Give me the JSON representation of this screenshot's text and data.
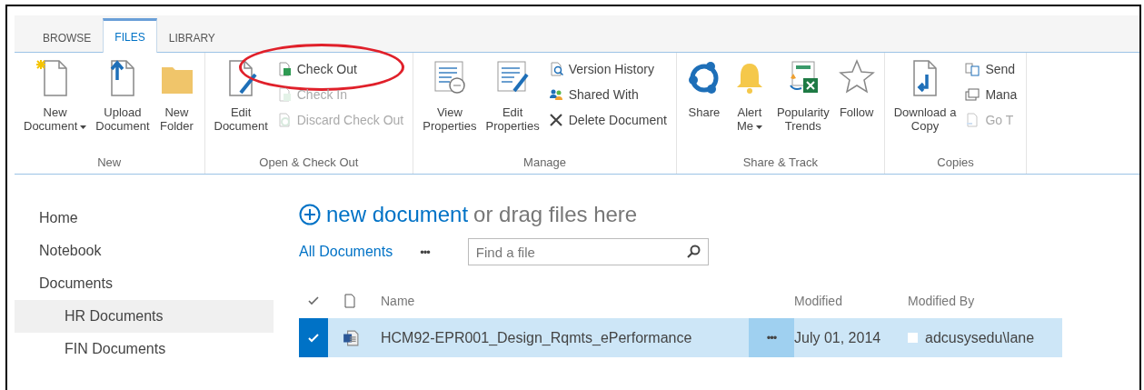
{
  "ribbon": {
    "tabs": [
      {
        "label": "BROWSE",
        "selected": false
      },
      {
        "label": "FILES",
        "selected": true
      },
      {
        "label": "LIBRARY",
        "selected": false
      }
    ],
    "groups": [
      {
        "label": "New",
        "items": [
          {
            "kind": "large",
            "lines": [
              "New",
              "Document"
            ],
            "dropdown": true
          },
          {
            "kind": "large",
            "lines": [
              "Upload",
              "Document"
            ],
            "dropdown": false
          },
          {
            "kind": "large",
            "lines": [
              "New",
              "Folder"
            ],
            "dropdown": false
          }
        ]
      },
      {
        "label": "Open & Check Out",
        "items": [
          {
            "kind": "large",
            "lines": [
              "Edit",
              "Document"
            ],
            "dropdown": false
          },
          {
            "kind": "stack",
            "items": [
              {
                "label": "Check Out",
                "disabled": false,
                "highlighted": true
              },
              {
                "label": "Check In",
                "disabled": true,
                "highlighted": false
              },
              {
                "label": "Discard Check Out",
                "disabled": true,
                "highlighted": false
              }
            ]
          }
        ]
      },
      {
        "label": "Manage",
        "items": [
          {
            "kind": "large",
            "lines": [
              "View",
              "Properties"
            ],
            "dropdown": false
          },
          {
            "kind": "large",
            "lines": [
              "Edit",
              "Properties"
            ],
            "dropdown": false
          },
          {
            "kind": "stack",
            "items": [
              {
                "label": "Version History",
                "disabled": false,
                "highlighted": false
              },
              {
                "label": "Shared With",
                "disabled": false,
                "highlighted": false
              },
              {
                "label": "Delete Document",
                "disabled": false,
                "highlighted": false
              }
            ]
          }
        ]
      },
      {
        "label": "Share & Track",
        "items": [
          {
            "kind": "large",
            "lines": [
              "Share"
            ],
            "dropdown": false
          },
          {
            "kind": "large",
            "lines": [
              "Alert",
              "Me"
            ],
            "dropdown": true
          },
          {
            "kind": "large",
            "lines": [
              "Popularity",
              "Trends"
            ],
            "dropdown": false
          },
          {
            "kind": "large",
            "lines": [
              "Follow"
            ],
            "dropdown": false
          }
        ]
      },
      {
        "label": "Copies",
        "items": [
          {
            "kind": "large",
            "lines": [
              "Download a",
              "Copy"
            ],
            "dropdown": false
          },
          {
            "kind": "stack",
            "items": [
              {
                "label": "Send",
                "disabled": false,
                "highlighted": false
              },
              {
                "label": "Mana",
                "disabled": false,
                "highlighted": false
              },
              {
                "label": "Go T",
                "disabled": true,
                "highlighted": false
              }
            ]
          }
        ]
      }
    ]
  },
  "sidebar": {
    "items": [
      {
        "label": "Home",
        "selected": false
      },
      {
        "label": "Notebook",
        "selected": false
      },
      {
        "label": "Documents",
        "selected": false,
        "children": [
          {
            "label": "HR Documents",
            "selected": true
          },
          {
            "label": "FIN Documents",
            "selected": false
          }
        ]
      }
    ]
  },
  "upload": {
    "link": "new document",
    "text": "or drag files here"
  },
  "views": {
    "current": "All Documents",
    "more": "•••",
    "search": {
      "placeholder": "Find a file"
    }
  },
  "table": {
    "columns": [
      "Name",
      "Modified",
      "Modified By"
    ],
    "rows": [
      {
        "name": "HCM92-EPR001_Design_Rqmts_ePerformance",
        "menu": "•••",
        "modified": "July 01, 2014",
        "modified_by": "adcusysedu\\lane",
        "selected": true
      }
    ]
  }
}
